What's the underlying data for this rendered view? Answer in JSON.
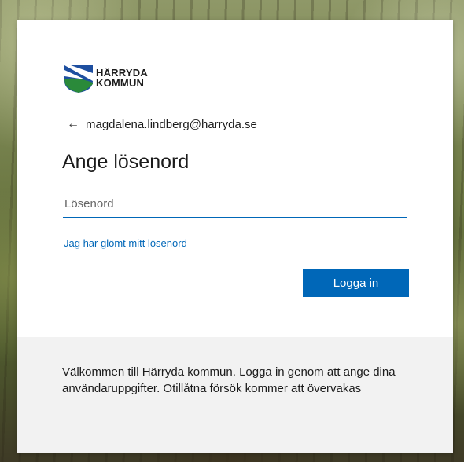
{
  "logo": {
    "line1": "HÄRRYDA",
    "line2": "KOMMUN",
    "icon": "harryda-coat-of-arms-icon",
    "colors": {
      "blue": "#1e4fa0",
      "green": "#2a8a3a",
      "white": "#ffffff"
    }
  },
  "account": {
    "back_icon": "arrow-left-icon",
    "back_glyph": "←",
    "email": "magdalena.lindberg@harryda.se"
  },
  "heading": "Ange lösenord",
  "password": {
    "value": "",
    "placeholder": "Lösenord"
  },
  "forgot_link": "Jag har glömt mitt lösenord",
  "signin_button": "Logga in",
  "footer": {
    "text": "Välkommen till Härryda kommun. Logga in genom att ange dina användaruppgifter. Otillåtna försök kommer att övervakas"
  },
  "colors": {
    "accent": "#0067b8",
    "footer_bg": "#f2f2f2",
    "card_bg": "#ffffff"
  }
}
